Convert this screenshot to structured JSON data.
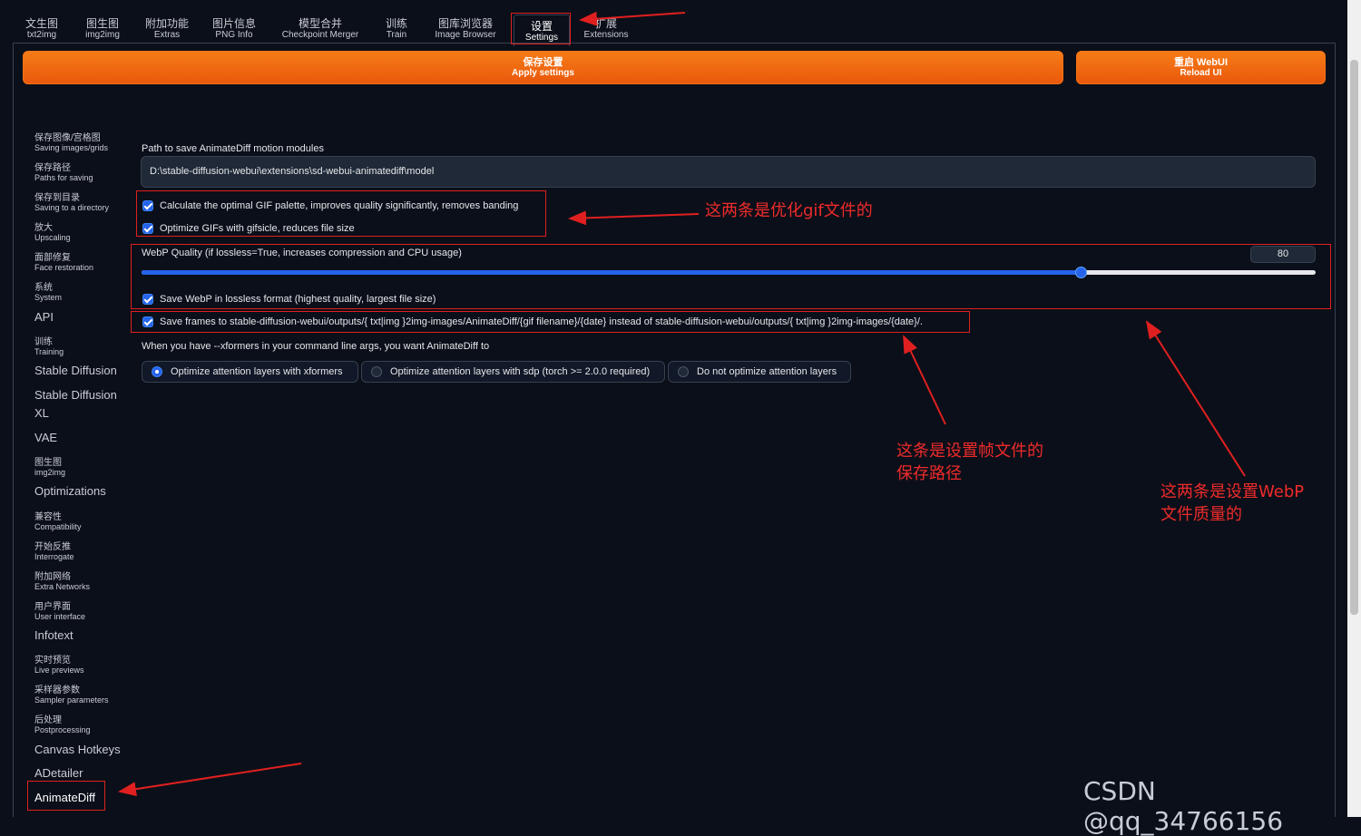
{
  "tabs": [
    {
      "zh": "文生图",
      "en": "txt2img"
    },
    {
      "zh": "图生图",
      "en": "img2img"
    },
    {
      "zh": "附加功能",
      "en": "Extras"
    },
    {
      "zh": "图片信息",
      "en": "PNG Info"
    },
    {
      "zh": "模型合并",
      "en": "Checkpoint Merger"
    },
    {
      "zh": "训练",
      "en": "Train"
    },
    {
      "zh": "图库浏览器",
      "en": "Image Browser"
    },
    {
      "zh": "设置",
      "en": "Settings"
    },
    {
      "zh": "扩展",
      "en": "Extensions"
    }
  ],
  "buttons": {
    "apply": {
      "zh": "保存设置",
      "en": "Apply settings"
    },
    "reload": {
      "zh": "重启 WebUI",
      "en": "Reload UI"
    }
  },
  "sidebar": [
    {
      "zh": "保存图像/宫格图",
      "en": "Saving images/grids"
    },
    {
      "zh": "保存路径",
      "en": "Paths for saving"
    },
    {
      "zh": "保存到目录",
      "en": "Saving to a directory"
    },
    {
      "zh": "放大",
      "en": "Upscaling"
    },
    {
      "zh": "面部修复",
      "en": "Face restoration"
    },
    {
      "zh": "系统",
      "en": "System"
    },
    {
      "label": "API"
    },
    {
      "zh": "训练",
      "en": "Training"
    },
    {
      "label": "Stable Diffusion"
    },
    {
      "label": "Stable Diffusion XL"
    },
    {
      "label": "VAE"
    },
    {
      "zh": "图生图",
      "en": "img2img"
    },
    {
      "label": "Optimizations"
    },
    {
      "zh": "兼容性",
      "en": "Compatibility"
    },
    {
      "zh": "开始反推",
      "en": "Interrogate"
    },
    {
      "zh": "附加网络",
      "en": "Extra Networks"
    },
    {
      "zh": "用户界面",
      "en": "User interface"
    },
    {
      "label": "Infotext"
    },
    {
      "zh": "实时预览",
      "en": "Live previews"
    },
    {
      "zh": "采样器参数",
      "en": "Sampler parameters"
    },
    {
      "zh": "后处理",
      "en": "Postprocessing"
    },
    {
      "label": "Canvas Hotkeys"
    },
    {
      "label": "ADetailer"
    },
    {
      "label": "AnimateDiff"
    }
  ],
  "settings": {
    "path_label": "Path to save AnimateDiff motion modules",
    "path_value": "D:\\stable-diffusion-webui\\extensions\\sd-webui-animatediff\\model",
    "gif_palette": "Calculate the optimal GIF palette, improves quality significantly, removes banding",
    "gifsicle": "Optimize GIFs with gifsicle, reduces file size",
    "webp_quality_label": "WebP Quality (if lossless=True, increases compression and CPU usage)",
    "webp_quality_value": "80",
    "webp_quality_fraction": 0.8,
    "webp_lossless": "Save WebP in lossless format (highest quality, largest file size)",
    "save_frames": "Save frames to stable-diffusion-webui/outputs/{ txt|img }2img-images/AnimateDiff/{gif filename}/{date} instead of stable-diffusion-webui/outputs/{ txt|img }2img-images/{date}/.",
    "xformers_label": "When you have --xformers in your command line args, you want AnimateDiff to",
    "radio_options": [
      "Optimize attention layers with xformers",
      "Optimize attention layers with sdp (torch >= 2.0.0 required)",
      "Do not optimize attention layers"
    ]
  },
  "annotations": {
    "gif_note": "这两条是优化gif文件的",
    "frames_note_1": "这条是设置帧文件的",
    "frames_note_2": "保存路径",
    "webp_note_1": "这两条是设置WebP",
    "webp_note_2": "文件质量的"
  },
  "watermark": "CSDN @qq_34766156",
  "colors": {
    "accent": "#ea580c",
    "checkbox": "#2563eb",
    "annotation": "#e02020",
    "background": "#0b0f19"
  }
}
